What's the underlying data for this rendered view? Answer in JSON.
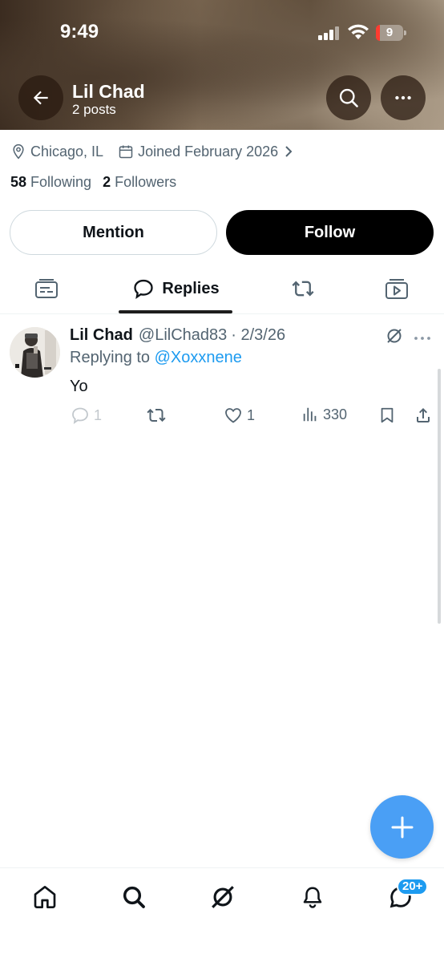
{
  "status_bar": {
    "time": "9:49",
    "battery": "9"
  },
  "header": {
    "name": "Lil Chad",
    "posts": "2 posts"
  },
  "profile": {
    "location": "Chicago, IL",
    "joined": "Joined February 2026",
    "following_count": "58",
    "following_label": "Following",
    "followers_count": "2",
    "followers_label": "Followers"
  },
  "buttons": {
    "mention": "Mention",
    "follow": "Follow"
  },
  "tabs": [
    {
      "icon": "highlights-icon",
      "label": ""
    },
    {
      "icon": "replies-icon",
      "label": "Replies",
      "active": true
    },
    {
      "icon": "repost-icon",
      "label": ""
    },
    {
      "icon": "media-icon",
      "label": ""
    }
  ],
  "post": {
    "name": "Lil Chad",
    "handle": "@LilChad83",
    "date": "· 2/3/26",
    "replying_prefix": "Replying to",
    "replying_to": "@Xoxxnene",
    "text": "Yo",
    "replies": "1",
    "likes": "1",
    "views": "330"
  },
  "bottom_nav": {
    "messages_badge": "20+"
  },
  "colors": {
    "accent": "#1d9bf0",
    "fab": "#4a9ff5",
    "muted": "#536471",
    "text": "#0f1419"
  }
}
